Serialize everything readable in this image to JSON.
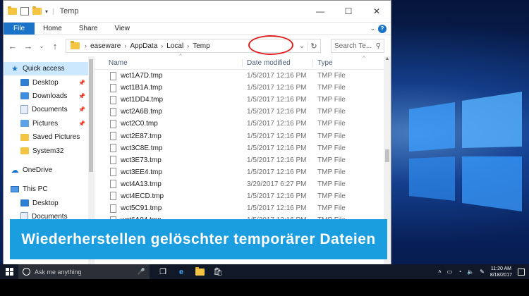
{
  "window": {
    "title": "Temp",
    "controls": {
      "minimize": "—",
      "maximize": "☐",
      "close": "✕"
    }
  },
  "ribbon": {
    "tabs": [
      "File",
      "Home",
      "Share",
      "View"
    ],
    "help": "?"
  },
  "address": {
    "breadcrumb": [
      "easeware",
      "AppData",
      "Local",
      "Temp"
    ],
    "search_placeholder": "Search Te..."
  },
  "sidebar": {
    "items": [
      {
        "label": "Quick access",
        "icon": "star-icon"
      },
      {
        "label": "Desktop",
        "icon": "desktop-icon",
        "pinned": true
      },
      {
        "label": "Downloads",
        "icon": "downloads-icon",
        "pinned": true
      },
      {
        "label": "Documents",
        "icon": "documents-icon",
        "pinned": true
      },
      {
        "label": "Pictures",
        "icon": "pictures-icon",
        "pinned": true
      },
      {
        "label": "Saved Pictures",
        "icon": "folder-icon"
      },
      {
        "label": "System32",
        "icon": "folder-icon"
      },
      {
        "label": "OneDrive",
        "icon": "cloud-icon"
      },
      {
        "label": "This PC",
        "icon": "pc-icon"
      },
      {
        "label": "Desktop",
        "icon": "desktop-icon"
      },
      {
        "label": "Documents",
        "icon": "documents-icon"
      }
    ]
  },
  "columns": {
    "name": "Name",
    "date": "Date modified",
    "type": "Type"
  },
  "files": [
    {
      "name": "wct1A7D.tmp",
      "date": "1/5/2017 12:16 PM",
      "type": "TMP File"
    },
    {
      "name": "wct1B1A.tmp",
      "date": "1/5/2017 12:16 PM",
      "type": "TMP File"
    },
    {
      "name": "wct1DD4.tmp",
      "date": "1/5/2017 12:16 PM",
      "type": "TMP File"
    },
    {
      "name": "wct2A6B.tmp",
      "date": "1/5/2017 12:16 PM",
      "type": "TMP File"
    },
    {
      "name": "wct2C0.tmp",
      "date": "1/5/2017 12:16 PM",
      "type": "TMP File"
    },
    {
      "name": "wct2E87.tmp",
      "date": "1/5/2017 12:16 PM",
      "type": "TMP File"
    },
    {
      "name": "wct3C8E.tmp",
      "date": "1/5/2017 12:16 PM",
      "type": "TMP File"
    },
    {
      "name": "wct3E73.tmp",
      "date": "1/5/2017 12:16 PM",
      "type": "TMP File"
    },
    {
      "name": "wct3EE4.tmp",
      "date": "1/5/2017 12:16 PM",
      "type": "TMP File"
    },
    {
      "name": "wct4A13.tmp",
      "date": "3/29/2017 6:27 PM",
      "type": "TMP File"
    },
    {
      "name": "wct4ECD.tmp",
      "date": "1/5/2017 12:16 PM",
      "type": "TMP File"
    },
    {
      "name": "wct5C91.tmp",
      "date": "1/5/2017 12:16 PM",
      "type": "TMP File"
    },
    {
      "name": "wct6A04.tmp",
      "date": "1/5/2017 12:16 PM",
      "type": "TMP File"
    }
  ],
  "banner": {
    "text": "Wiederherstellen gelöschter temporärer Dateien"
  },
  "taskbar": {
    "search_placeholder": "Ask me anything",
    "time": "11:20 AM",
    "date": "8/18/2017"
  },
  "colors": {
    "accent": "#1a73c8",
    "banner": "#1b9ee0",
    "annotation_circle": "#e02020"
  }
}
